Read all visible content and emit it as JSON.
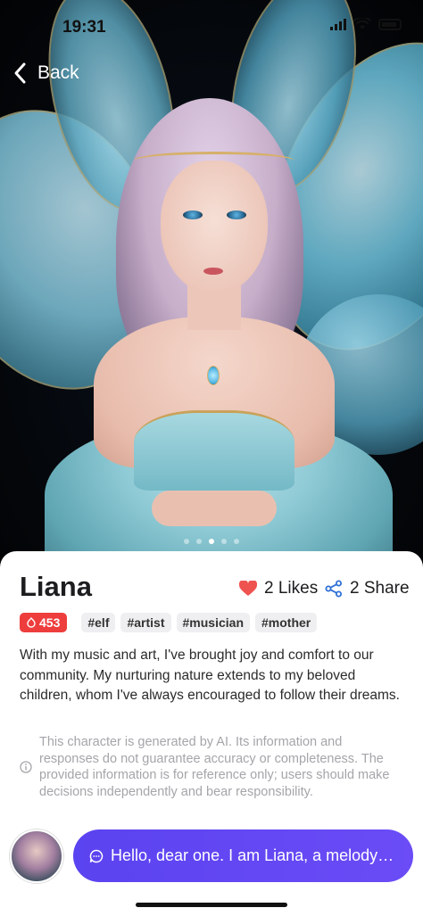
{
  "status_bar": {
    "time": "19:31"
  },
  "nav": {
    "back_label": "Back"
  },
  "carousel": {
    "page_count": 5,
    "active_index": 2
  },
  "character": {
    "name": "Liana",
    "likes_label": "2 Likes",
    "share_label": "2 Share",
    "heat": "453",
    "tags": [
      "#elf",
      "#artist",
      "#musician",
      "#mother"
    ],
    "bio": "With my music and art, I've brought joy and comfort to our community. My nurturing nature extends to my beloved children, whom I've always encouraged to follow their dreams.",
    "disclaimer": "This character is generated by AI. Its information and responses do not guarantee accuracy or completeness. The provided information is for reference only; users should make decisions independently and bear responsibility."
  },
  "chat": {
    "greeting": "Hello, dear one. I am Liana, a melody w..."
  },
  "colors": {
    "heart": "#ef5350",
    "hot_badge": "#ee3d3d",
    "chat_button": "#5a43f0",
    "share_icon": "#2f6fd6"
  },
  "icons": [
    "chevron-left-icon",
    "heart-icon",
    "share-icon",
    "flame-icon",
    "info-icon",
    "chat-bubble-icon"
  ]
}
